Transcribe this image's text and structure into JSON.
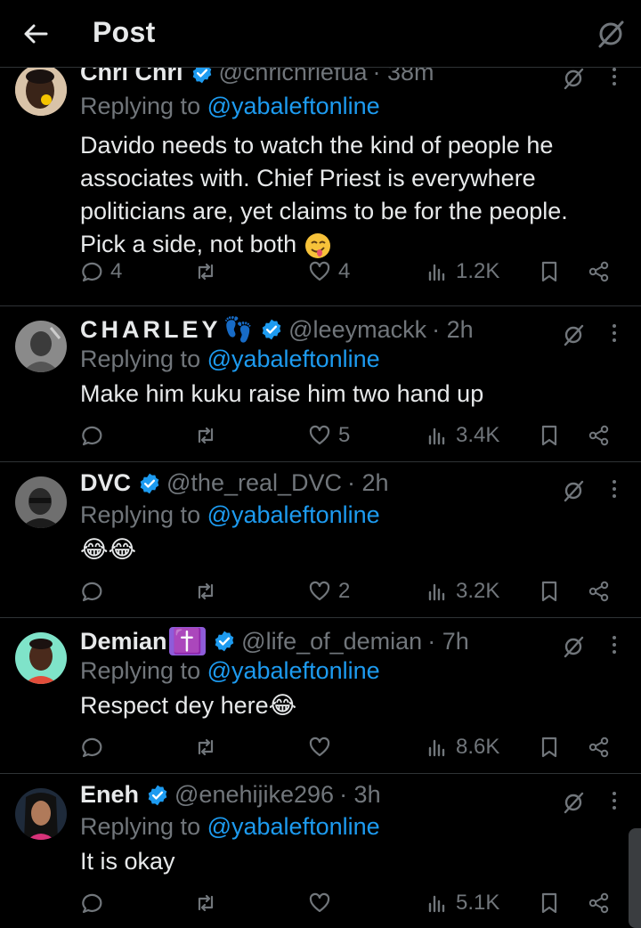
{
  "header": {
    "title": "Post"
  },
  "posts": [
    {
      "name": "Chri Chri",
      "handle": "@chrichriefua",
      "time": "· 38m",
      "reply_prefix": "Replying to ",
      "reply_to": "@yabaleftonline",
      "text": "Davido needs to watch the kind of people he associates with. Chief Priest is everywhere politicians are, yet claims to be for the people. Pick a side, not both",
      "replies": "4",
      "retweets": "",
      "likes": "4",
      "views": "1.2K"
    },
    {
      "name": "CHARLEY",
      "name_emoji": "👣",
      "handle": "@leeymackk",
      "time": "· 2h",
      "reply_prefix": "Replying to ",
      "reply_to": "@yabaleftonline",
      "text": "Make him kuku raise him two hand up",
      "replies": "",
      "retweets": "",
      "likes": "5",
      "views": "3.4K"
    },
    {
      "name": "DVC",
      "handle": "@the_real_DVC",
      "time": "· 2h",
      "reply_prefix": "Replying to ",
      "reply_to": "@yabaleftonline",
      "text": "😂😂",
      "replies": "",
      "retweets": "",
      "likes": "2",
      "views": "3.2K"
    },
    {
      "name": "Demian",
      "name_emoji": "✝️",
      "handle": "@life_of_demian",
      "time": "· 7h",
      "reply_prefix": "Replying to ",
      "reply_to": "@yabaleftonline",
      "text": "Respect dey here😂",
      "replies": "",
      "retweets": "",
      "likes": "",
      "views": "8.6K"
    },
    {
      "name": "Eneh",
      "handle": "@enehijike296",
      "time": "· 3h",
      "reply_prefix": "Replying to ",
      "reply_to": "@yabaleftonline",
      "text": "It is okay",
      "replies": "",
      "retweets": "",
      "likes": "",
      "views": "5.1K"
    }
  ],
  "colors": {
    "background": "#000000",
    "text": "#e7e9ea",
    "muted": "#71767b",
    "link": "#1d9bf0",
    "divider": "#2f3336"
  },
  "icons": [
    "back-arrow-icon",
    "grok-icon",
    "verified-badge-icon",
    "more-icon",
    "reply-icon",
    "retweet-icon",
    "like-icon",
    "views-icon",
    "bookmark-icon",
    "share-icon"
  ]
}
